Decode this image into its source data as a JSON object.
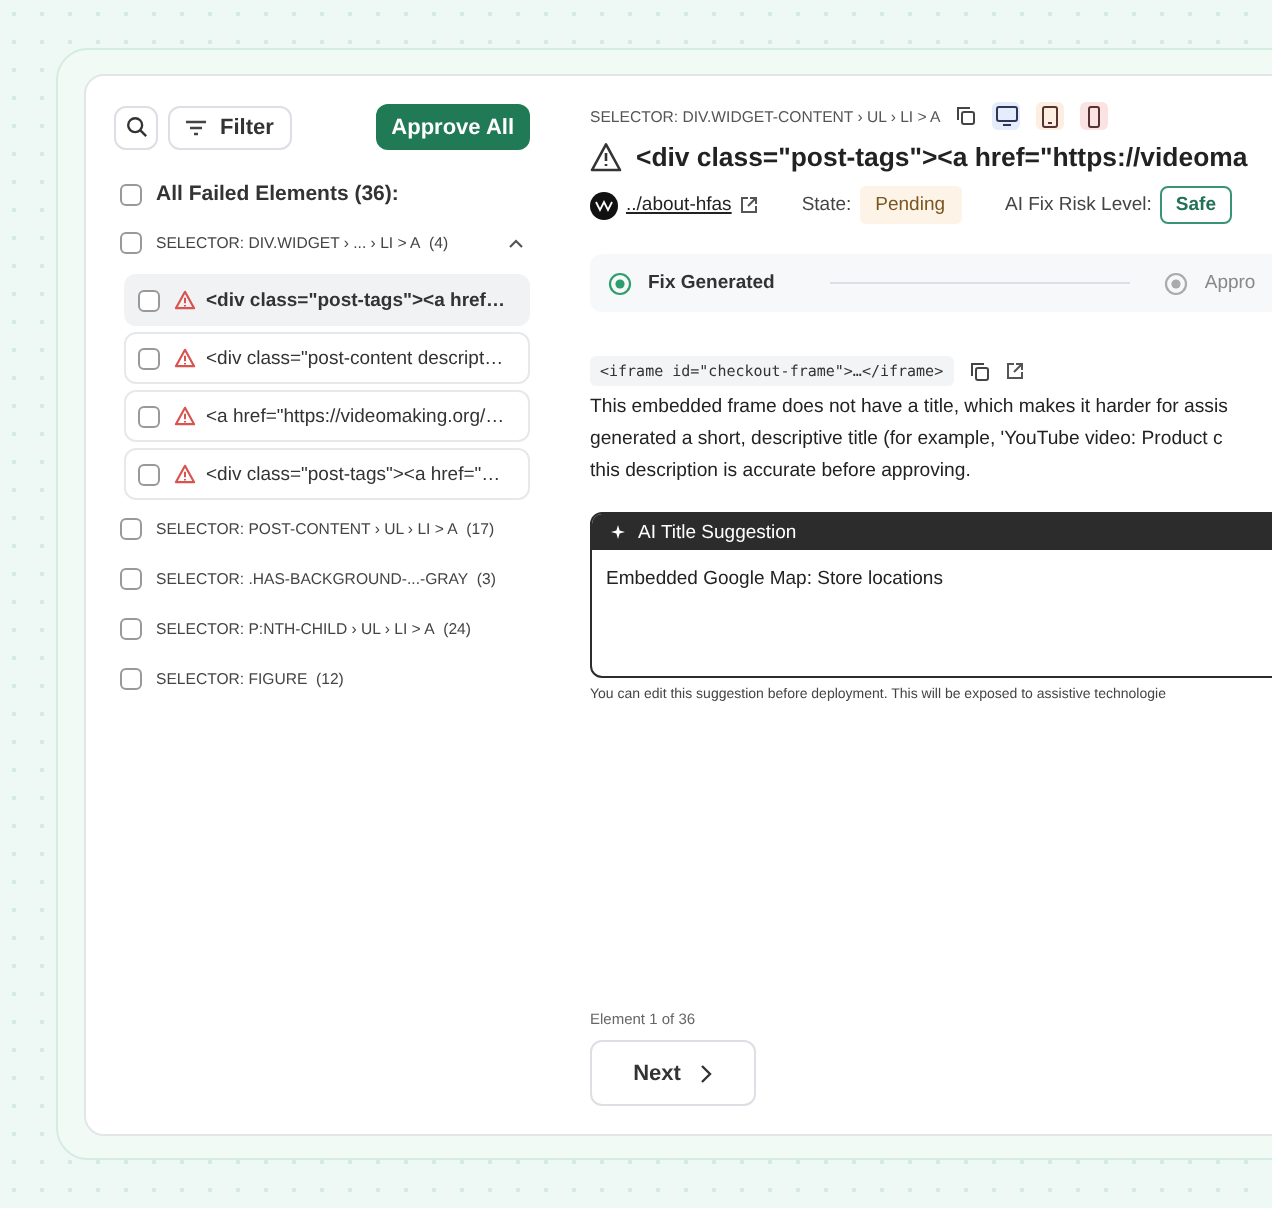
{
  "toolbar": {
    "filter_label": "Filter",
    "approve_all_label": "Approve All"
  },
  "all_failed": {
    "label": "All Failed Elements (36):",
    "checked": false
  },
  "groups": [
    {
      "label": "SELECTOR: DIV.WIDGET › ... › LI > A",
      "count": "(4)",
      "checked": false,
      "expanded": true,
      "items": [
        {
          "label": "<div class=\"post-tags\"><a href…",
          "checked": false,
          "selected": true
        },
        {
          "label": "<div class=\"post-content descript…",
          "checked": false,
          "selected": false
        },
        {
          "label": "<a href=\"https://videomaking.org/…",
          "checked": false,
          "selected": false
        },
        {
          "label": "<div class=\"post-tags\"><a href=\"…",
          "checked": false,
          "selected": false
        }
      ]
    },
    {
      "label": "SELECTOR: POST-CONTENT › UL › LI > A",
      "count": "(17)",
      "checked": false,
      "expanded": false
    },
    {
      "label": "SELECTOR: .HAS-BACKGROUND-...-GRAY",
      "count": "(3)",
      "checked": false,
      "expanded": false
    },
    {
      "label": "SELECTOR: P:NTH-CHILD › UL › LI > A",
      "count": "(24)",
      "checked": false,
      "expanded": false
    },
    {
      "label": "SELECTOR: FIGURE",
      "count": "(12)",
      "checked": false,
      "expanded": false
    }
  ],
  "selector_path": "SELECTOR: DIV.WIDGET-CONTENT › UL › LI > A",
  "device_views": [
    {
      "kind": "desktop",
      "color": "#e3edfb"
    },
    {
      "kind": "tablet",
      "color": "#fcefe1"
    },
    {
      "kind": "mobile",
      "color": "#fce3e3"
    }
  ],
  "title": "<div class=\"post-tags\"><a href=\"https://videoma",
  "page_link": "../about-hfas",
  "state_label": "State:",
  "state": "Pending",
  "risk_label": "AI Fix Risk Level:",
  "risk": "Safe",
  "steps": [
    {
      "label": "Fix Generated",
      "done": true
    },
    {
      "label": "Appro",
      "done": false
    }
  ],
  "code_snippet": "<iframe id=\"checkout-frame\">…</iframe>",
  "description_lines": [
    "This embedded frame does not have a title, which makes it harder for assis",
    "generated a short, descriptive title (for example, 'YouTube video: Product c",
    "this description is accurate before approving."
  ],
  "suggestion": {
    "title": "AI Title Suggestion",
    "value": "Embedded Google Map: Store locations"
  },
  "hint": "You can edit this suggestion before deployment. This will be exposed to assistive technologie",
  "pager": {
    "position": "Element 1 of 36",
    "next_label": "Next"
  }
}
